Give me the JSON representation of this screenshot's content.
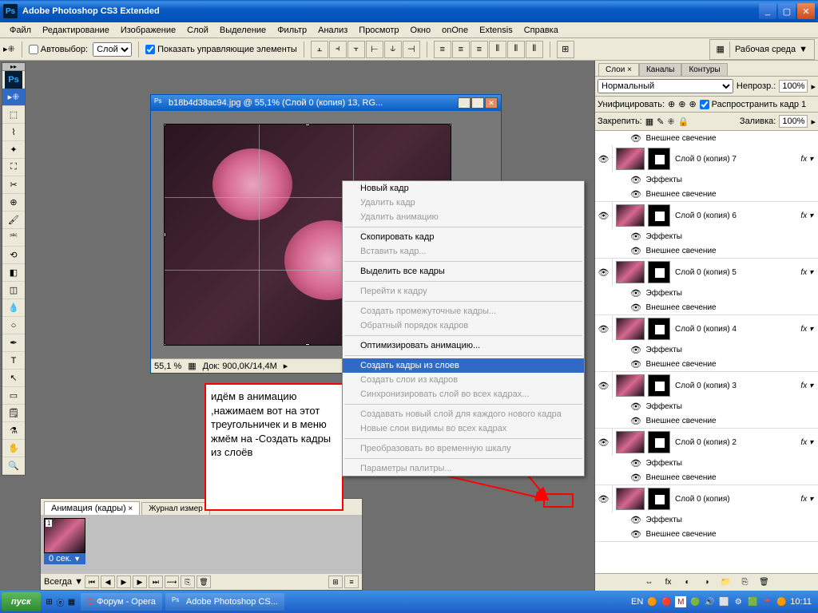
{
  "titlebar": {
    "app": "Adobe Photoshop CS3 Extended"
  },
  "menubar": [
    "Файл",
    "Редактирование",
    "Изображение",
    "Слой",
    "Выделение",
    "Фильтр",
    "Анализ",
    "Просмотр",
    "Окно",
    "onOne",
    "Extensis",
    "Справка"
  ],
  "options": {
    "autoselect": "Автовыбор:",
    "autoselect_val": "Слой",
    "show_controls": "Показать управляющие элементы",
    "workspace": "Рабочая среда"
  },
  "doc": {
    "title": "b18b4d38ac94.jpg @ 55,1% (Слой 0 (копия) 13, RG...",
    "zoom": "55,1 %",
    "info": "Док: 900,0K/14,4M"
  },
  "context_menu": [
    {
      "label": "Новый кадр",
      "d": false
    },
    {
      "label": "Удалить кадр",
      "d": true
    },
    {
      "label": "Удалить анимацию",
      "d": true
    },
    {
      "sep": true
    },
    {
      "label": "Скопировать кадр",
      "d": false
    },
    {
      "label": "Вставить кадр...",
      "d": true
    },
    {
      "sep": true
    },
    {
      "label": "Выделить все кадры",
      "d": false
    },
    {
      "sep": true
    },
    {
      "label": "Перейти к кадру",
      "d": true
    },
    {
      "sep": true
    },
    {
      "label": "Создать промежуточные кадры...",
      "d": true
    },
    {
      "label": "Обратный порядок кадров",
      "d": true
    },
    {
      "sep": true
    },
    {
      "label": "Оптимизировать анимацию...",
      "d": false
    },
    {
      "sep": true
    },
    {
      "label": "Создать кадры из слоев",
      "hl": true
    },
    {
      "label": "Создать слои из кадров",
      "d": true,
      "cut": true
    },
    {
      "label": "Синхронизировать слой во всех кадрах...",
      "d": true,
      "cut": true
    },
    {
      "sep": true
    },
    {
      "label": "Создавать новый слой для каждого нового кадра",
      "d": true,
      "cut": true
    },
    {
      "label": "Новые слои видимы во всех кадрах",
      "d": true,
      "cut": true
    },
    {
      "sep": true
    },
    {
      "label": "Преобразовать во временную шкалу",
      "d": true,
      "cut": true
    },
    {
      "sep": true
    },
    {
      "label": "Параметры палитры...",
      "d": true,
      "cut": true
    }
  ],
  "annotation": "идём в анимацию ,нажимаем вот на этот треугольничек и в меню жмём на -Создать кадры из слоёв",
  "anim": {
    "tab1": "Анимация (кадры)",
    "tab2": "Журнал измер",
    "frame_num": "1",
    "frame_time": "0 сек.",
    "loop": "Всегда"
  },
  "layers_panel": {
    "tabs": [
      "Слои",
      "Каналы",
      "Контуры"
    ],
    "blend": "Нормальный",
    "opacity_lbl": "Непрозр.:",
    "opacity": "100%",
    "unify": "Унифицировать:",
    "propagate": "Распространить кадр 1",
    "lock": "Закрепить:",
    "fill_lbl": "Заливка:",
    "fill": "100%",
    "fx_label": "Эффекты",
    "glow": "Внешнее свечение"
  },
  "layers": [
    {
      "name": "Слой 0 (копия) 7"
    },
    {
      "name": "Слой 0 (копия) 6"
    },
    {
      "name": "Слой 0 (копия) 5"
    },
    {
      "name": "Слой 0 (копия) 4"
    },
    {
      "name": "Слой 0 (копия) 3"
    },
    {
      "name": "Слой 0 (копия) 2"
    },
    {
      "name": "Слой 0 (копия)"
    }
  ],
  "taskbar": {
    "task1": "Форум - Opera",
    "task2": "Adobe Photoshop CS...",
    "lang": "EN",
    "time": "10:11"
  }
}
